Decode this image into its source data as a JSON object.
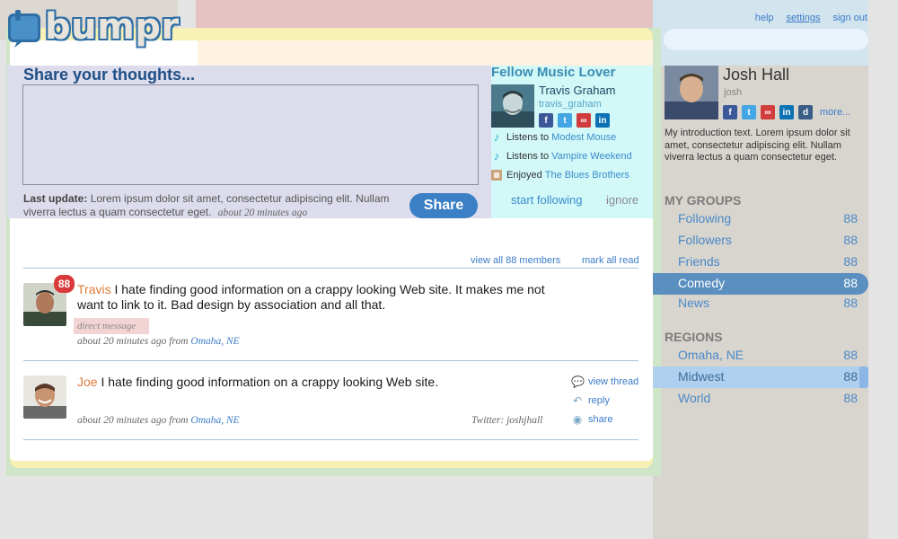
{
  "brand": {
    "logo_text": "bumpr"
  },
  "top_links": {
    "help": "help",
    "settings": "settings",
    "sign_out": "sign out"
  },
  "share": {
    "title": "Share your thoughts...",
    "button": "Share",
    "last_update_label": "Last update:",
    "last_update_text": "Lorem ipsum dolor sit amet, consectetur adipiscing elit. Nullam viverra lectus a quam consectetur eget.",
    "last_update_time": "about 20 minutes ago"
  },
  "fellow": {
    "title": "Fellow Music Lover",
    "name": "Travis Graham",
    "handle": "travis_graham",
    "activities": [
      {
        "prefix": "Listens to",
        "link": "Modest Mouse"
      },
      {
        "prefix": "Listens to",
        "link": "Vampire Weekend"
      },
      {
        "prefix": "Enjoyed",
        "link": "The Blues Brothers"
      }
    ],
    "start_following": "start following",
    "ignore": "ignore"
  },
  "feed": {
    "view_all": "view all 88 members",
    "mark_all_read": "mark all read",
    "posts": [
      {
        "author": "Travis",
        "badge": "88",
        "text_line1": "I hate finding good information on a crappy looking Web site. It makes me not",
        "text_line2": "want to link to it. Bad design by association and all that.",
        "tag": "direct message",
        "time": "about 20 minutes ago from",
        "location": "Omaha, NE"
      },
      {
        "author": "Joe",
        "text_line1": "I hate finding good information on a crappy looking Web site.",
        "time": "about 20 minutes ago from",
        "location": "Omaha, NE",
        "twitter": "Twitter: joshjhall",
        "actions": {
          "view_thread": "view thread",
          "reply": "reply",
          "share": "share"
        }
      }
    ]
  },
  "profile": {
    "name": "Josh Hall",
    "handle": "josh",
    "more": "more...",
    "intro": "My introduction text. Lorem ipsum dolor sit amet, consectetur adipiscing elit. Nullam viverra lectus a quam consectetur eget."
  },
  "groups": {
    "heading": "MY GROUPS",
    "items": [
      {
        "label": "Following",
        "count": "88"
      },
      {
        "label": "Followers",
        "count": "88"
      },
      {
        "label": "Friends",
        "count": "88"
      },
      {
        "label": "Comedy",
        "count": "88",
        "active": true
      },
      {
        "label": "News",
        "count": "88"
      }
    ]
  },
  "regions": {
    "heading": "REGIONS",
    "items": [
      {
        "label": "Omaha, NE",
        "count": "88"
      },
      {
        "label": "Midwest",
        "count": "88",
        "highlighted": true
      },
      {
        "label": "World",
        "count": "88"
      }
    ]
  },
  "colors": {
    "brand_blue": "#2f6fa6",
    "link_blue": "#3a7bc8",
    "share_button": "#3b7fc4",
    "badge_red": "#d9393a",
    "author_orange": "#e07a3a",
    "active_group": "#5b8fc0",
    "highlight_group": "#aecfee"
  },
  "icons": {
    "social": [
      "facebook-icon",
      "twitter-icon",
      "lastfm-icon",
      "linkedin-icon"
    ],
    "profile_social": [
      "facebook-icon",
      "twitter-icon",
      "lastfm-icon",
      "linkedin-icon",
      "delicious-icon"
    ],
    "activity": [
      "music-note-icon",
      "music-note-icon",
      "film-icon"
    ],
    "post_actions": [
      "speech-bubble-icon",
      "reply-arrow-icon",
      "broadcast-icon"
    ]
  }
}
